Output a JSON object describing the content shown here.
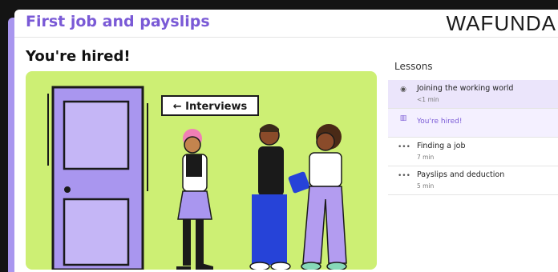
{
  "header": {
    "course_title": "First job and payslips",
    "logo": "WAFUNDA"
  },
  "main": {
    "lesson_title": "You're hired!",
    "sign_text": "← Interviews"
  },
  "sidebar": {
    "heading": "Lessons",
    "items": [
      {
        "icon": "eye-icon",
        "glyph": "◉",
        "title": "Joining the working world",
        "duration": "<1 min",
        "state": "active"
      },
      {
        "icon": "book-icon",
        "glyph": "▥",
        "title": "You're hired!",
        "duration": "",
        "state": "current"
      },
      {
        "icon": "dots-icon",
        "glyph": "•••",
        "title": "Finding a job",
        "duration": "7 min",
        "state": "default"
      },
      {
        "icon": "dots-icon",
        "glyph": "•••",
        "title": "Payslips and deduction",
        "duration": "5 min",
        "state": "default"
      }
    ]
  },
  "colors": {
    "accent": "#7a5ad6",
    "illustration_bg": "#cdef74",
    "door": "#a996ef"
  }
}
